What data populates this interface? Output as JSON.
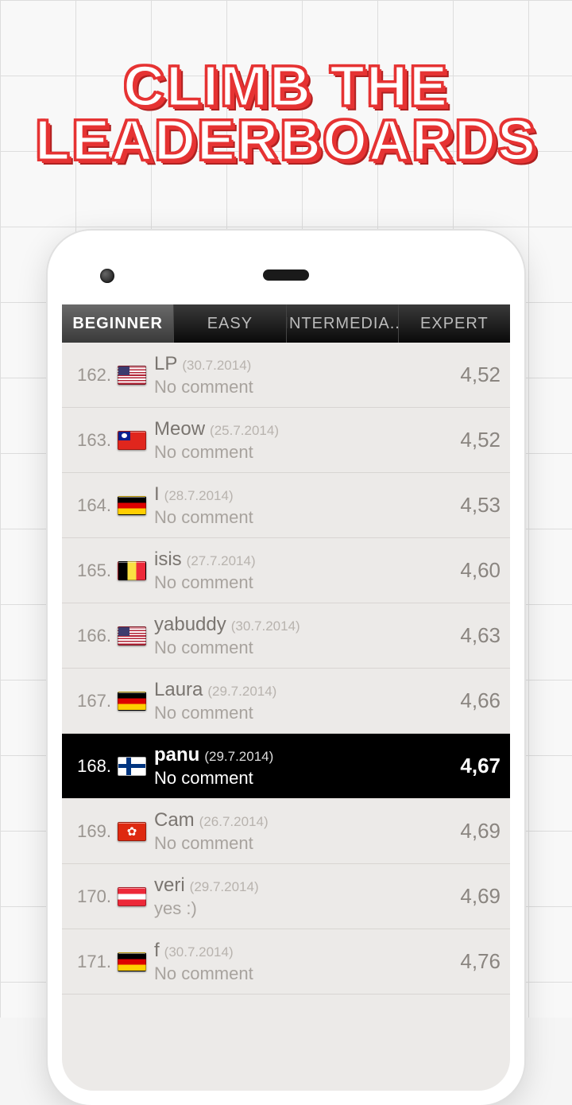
{
  "headline": {
    "line1": "CLIMB THE",
    "line2": "LEADERBOARDS"
  },
  "tabs": [
    {
      "label": "BEGINNER",
      "active": true
    },
    {
      "label": "EASY",
      "active": false
    },
    {
      "label": "INTERMEDIA..",
      "active": false
    },
    {
      "label": "EXPERT",
      "active": false
    }
  ],
  "rows": [
    {
      "rank": "162.",
      "flag": "us",
      "name": "LP",
      "date": "(30.7.2014)",
      "comment": "No comment",
      "score": "4,52",
      "highlight": false
    },
    {
      "rank": "163.",
      "flag": "tw",
      "name": "Meow",
      "date": "(25.7.2014)",
      "comment": "No comment",
      "score": "4,52",
      "highlight": false
    },
    {
      "rank": "164.",
      "flag": "de",
      "name": "I",
      "date": "(28.7.2014)",
      "comment": "No comment",
      "score": "4,53",
      "highlight": false
    },
    {
      "rank": "165.",
      "flag": "be",
      "name": "isis",
      "date": "(27.7.2014)",
      "comment": "No comment",
      "score": "4,60",
      "highlight": false
    },
    {
      "rank": "166.",
      "flag": "us",
      "name": "yabuddy",
      "date": "(30.7.2014)",
      "comment": "No comment",
      "score": "4,63",
      "highlight": false
    },
    {
      "rank": "167.",
      "flag": "de",
      "name": "Laura",
      "date": "(29.7.2014)",
      "comment": "No comment",
      "score": "4,66",
      "highlight": false
    },
    {
      "rank": "168.",
      "flag": "fi",
      "name": "panu",
      "date": "(29.7.2014)",
      "comment": "No comment",
      "score": "4,67",
      "highlight": true
    },
    {
      "rank": "169.",
      "flag": "hk",
      "name": "Cam",
      "date": "(26.7.2014)",
      "comment": "No comment",
      "score": "4,69",
      "highlight": false
    },
    {
      "rank": "170.",
      "flag": "at",
      "name": "veri",
      "date": "(29.7.2014)",
      "comment": "yes :)",
      "score": "4,69",
      "highlight": false
    },
    {
      "rank": "171.",
      "flag": "de",
      "name": "f",
      "date": "(30.7.2014)",
      "comment": "No comment",
      "score": "4,76",
      "highlight": false
    }
  ]
}
